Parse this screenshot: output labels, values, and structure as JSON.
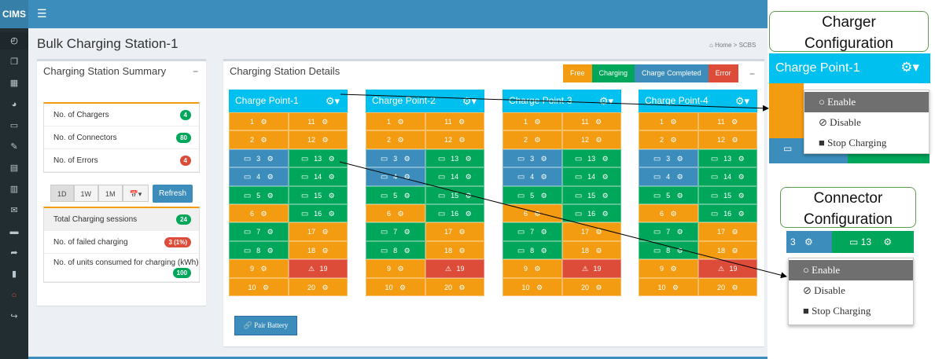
{
  "app": {
    "brand": "CIMS",
    "menu_icon": "hamburger-icon"
  },
  "sidebar_icons": [
    "dashboard-icon",
    "copy-icon",
    "grid-icon",
    "pie-chart-icon",
    "laptop-icon",
    "edit-icon",
    "table-icon",
    "calendar-icon",
    "envelope-icon",
    "folder-icon",
    "share-icon",
    "book-icon",
    "circle-icon",
    "sign-out-icon"
  ],
  "page": {
    "title": "Bulk Charging Station-1",
    "breadcrumb": {
      "home": "Home",
      "sep": ">",
      "current": "SCBS"
    }
  },
  "summary": {
    "title": "Charging Station Summary",
    "collapse": "−",
    "stats": [
      {
        "label": "No. of Chargers",
        "value": "4",
        "color": "#00a65a"
      },
      {
        "label": "No. of Connectors",
        "value": "80",
        "color": "#00a65a"
      },
      {
        "label": "No. of Errors",
        "value": "4",
        "color": "#dd4b39"
      }
    ],
    "ranges": [
      "1D",
      "1W",
      "1M",
      "📅▾"
    ],
    "refresh": "Refresh",
    "sessions": [
      {
        "label": "Total Charging sessions",
        "value": "24",
        "color": "#00a65a"
      },
      {
        "label": "No. of failed charging",
        "value": "3 (1%)",
        "color": "#dd4b39"
      },
      {
        "label": "No. of units consumed for charging (kWh)",
        "value": "100",
        "color": "#00a65a"
      }
    ]
  },
  "details": {
    "title": "Charging Station Details",
    "collapse": "−",
    "legend": [
      {
        "label": "Free",
        "color": "#f39c12"
      },
      {
        "label": "Charging",
        "color": "#00a65a"
      },
      {
        "label": "Charge Completed",
        "color": "#3c8dbc"
      },
      {
        "label": "Error",
        "color": "#dd4b39"
      }
    ],
    "charge_points": [
      {
        "name": "Charge Point-1",
        "errors": [
          19
        ]
      },
      {
        "name": "Charge Point-2",
        "errors": [
          19
        ]
      },
      {
        "name": "Charge Point-3",
        "errors": [
          19
        ]
      },
      {
        "name": "Charge Point-4",
        "errors": [
          19
        ]
      }
    ],
    "connectors_left": [
      {
        "n": "1",
        "state": "free"
      },
      {
        "n": "2",
        "state": "free"
      },
      {
        "n": "3",
        "state": "done"
      },
      {
        "n": "4",
        "state": "done"
      },
      {
        "n": "5",
        "state": "charging"
      },
      {
        "n": "6",
        "state": "free"
      },
      {
        "n": "7",
        "state": "charging"
      },
      {
        "n": "8",
        "state": "charging"
      },
      {
        "n": "9",
        "state": "free"
      },
      {
        "n": "10",
        "state": "free"
      }
    ],
    "connectors_right": [
      {
        "n": "11",
        "state": "free"
      },
      {
        "n": "12",
        "state": "free"
      },
      {
        "n": "13",
        "state": "charging"
      },
      {
        "n": "14",
        "state": "charging"
      },
      {
        "n": "15",
        "state": "charging"
      },
      {
        "n": "16",
        "state": "charging"
      },
      {
        "n": "17",
        "state": "free"
      },
      {
        "n": "18",
        "state": "free"
      },
      {
        "n": "19",
        "state": "err"
      },
      {
        "n": "20",
        "state": "free"
      }
    ],
    "pair_button": "Pair Battery"
  },
  "charger_config": {
    "title": "Charger\nConfiguration",
    "head": "Charge Point-1",
    "options": [
      "Enable",
      "Disable",
      "Stop Charging"
    ],
    "selected": "Enable"
  },
  "connector_config": {
    "title": "Connector\nConfiguration",
    "left": "3",
    "right": "13",
    "options": [
      "Enable",
      "Disable",
      "Stop Charging"
    ],
    "selected": "Enable"
  }
}
